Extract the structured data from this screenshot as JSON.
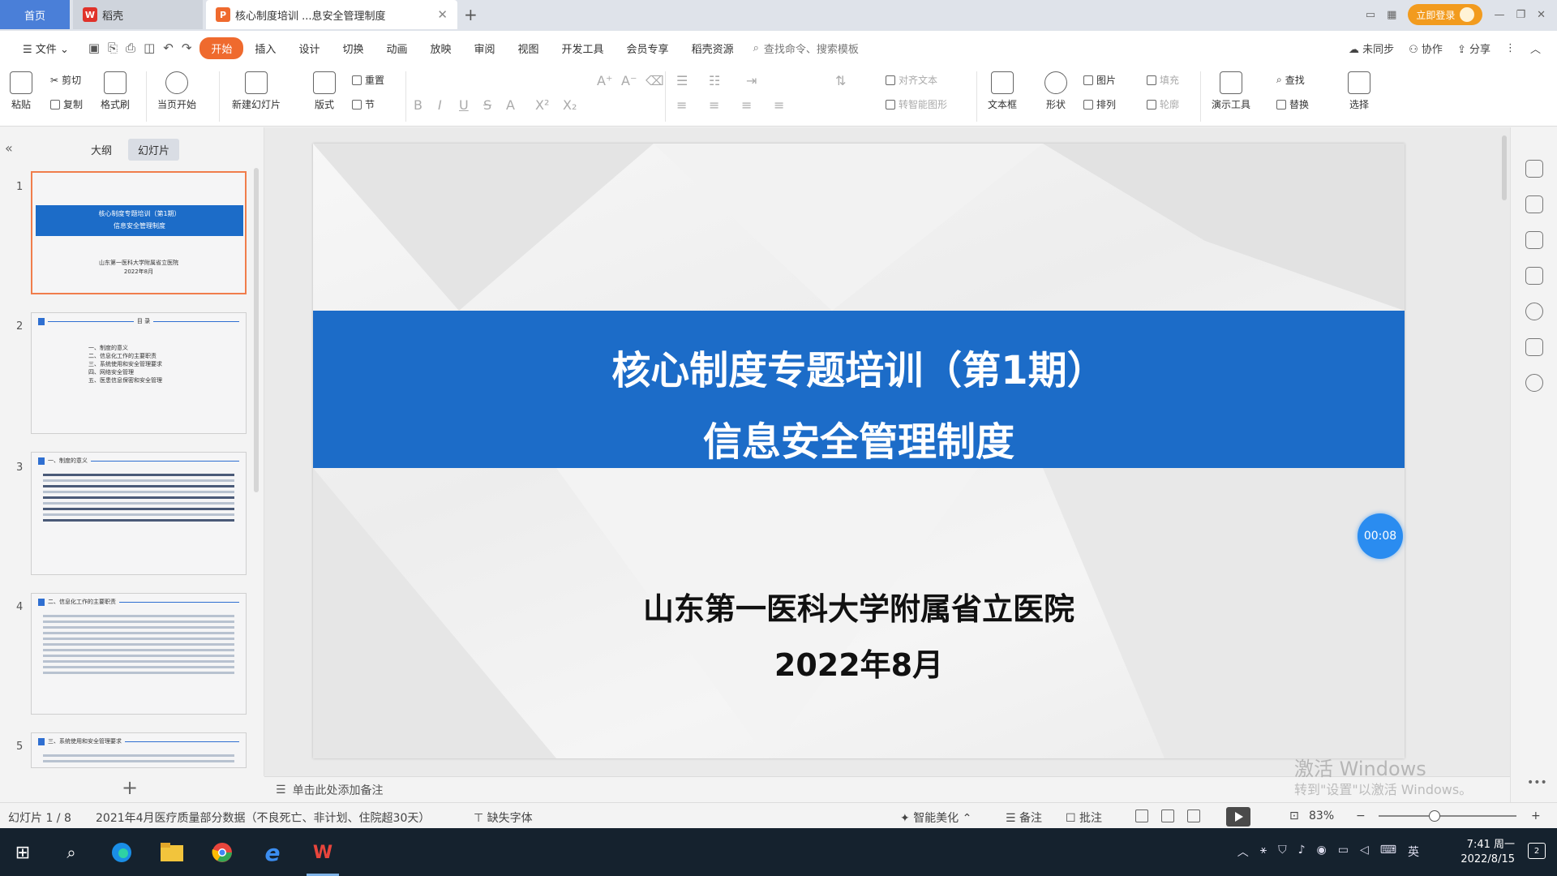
{
  "tabs": {
    "home": "首页",
    "wps": "稻壳",
    "doc": "核心制度培训 ...息安全管理制度"
  },
  "titlebar": {
    "login": "立即登录"
  },
  "menu": {
    "file": "文件",
    "items": [
      "开始",
      "插入",
      "设计",
      "切换",
      "动画",
      "放映",
      "审阅",
      "视图",
      "开发工具",
      "会员专享",
      "稻壳资源"
    ],
    "search": "查找命令、搜索模板",
    "sync": "未同步",
    "collab": "协作",
    "share": "分享"
  },
  "ribbon": {
    "paste": "粘贴",
    "cut": "剪切",
    "copy": "复制",
    "format_painter": "格式刷",
    "from_current": "当页开始",
    "new_slide": "新建幻灯片",
    "layout": "版式",
    "section": "节",
    "reset": "重置",
    "align_text": "对齐文本",
    "smart_art": "转智能图形",
    "textbox": "文本框",
    "shape": "形状",
    "arrange": "排列",
    "picture": "图片",
    "fill": "填充",
    "outline": "轮廓",
    "present_tools": "演示工具",
    "find": "查找",
    "replace": "替换",
    "select": "选择"
  },
  "left_panel": {
    "tab_outline": "大纲",
    "tab_slides": "幻灯片",
    "thumbs": [
      {
        "num": "1",
        "title": "核心制度专题培训（第1期）",
        "subtitle": "信息安全管理制度",
        "org": "山东第一医科大学附属省立医院",
        "date": "2022年8月"
      },
      {
        "num": "2",
        "heading": "目 录",
        "lines": [
          "一、制度的意义",
          "二、信息化工作的主要职责",
          "三、系统使用和安全管理要求",
          "四、网络安全管理",
          "五、医患信息保密和安全管理"
        ]
      },
      {
        "num": "3",
        "heading": "一、制度的意义"
      },
      {
        "num": "4",
        "heading": "二、信息化工作的主要职责"
      },
      {
        "num": "5",
        "heading": "三、系统使用和安全管理要求"
      }
    ]
  },
  "slide": {
    "title1": "核心制度专题培训（第1期）",
    "title2": "信息安全管理制度",
    "org": "山东第一医科大学附属省立医院",
    "date": "2022年8月"
  },
  "timer": "00:08",
  "notes_placeholder": "单击此处添加备注",
  "watermark": {
    "line1": "激活 Windows",
    "line2": "转到\"设置\"以激活 Windows。"
  },
  "status": {
    "slide_pos": "幻灯片 1 / 8",
    "theme": "2021年4月医疗质量部分数据（不良死亡、非计划、住院超30天）",
    "missing_font": "缺失字体",
    "beautify": "智能美化",
    "notes": "备注",
    "comments": "批注",
    "zoom": "83%"
  },
  "taskbar": {
    "time": "7:41 周一",
    "date": "2022/8/15",
    "lang": "英"
  },
  "colors": {
    "accent": "#1c6cc8",
    "menu_active": "#ef6a2e",
    "taskbar": "#15222e"
  }
}
